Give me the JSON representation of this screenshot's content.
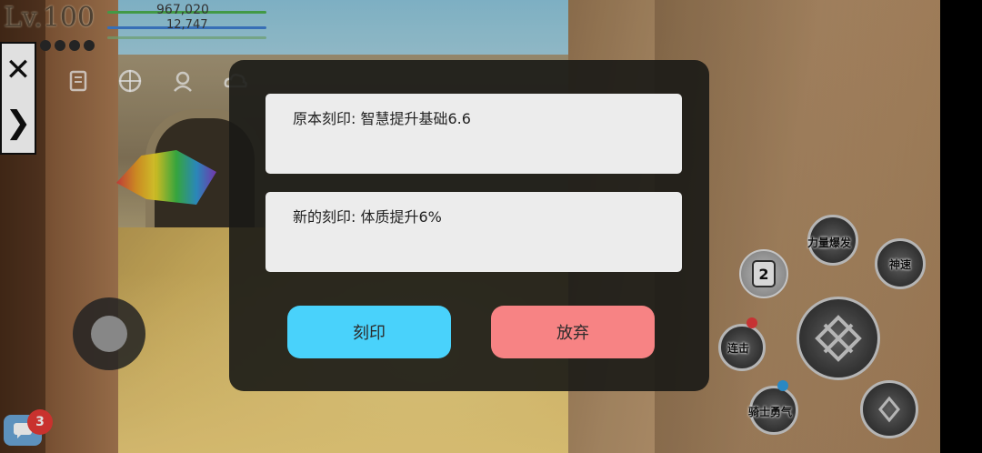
{
  "hud": {
    "level": "Lv.100",
    "hp_value": "967,020",
    "mp_value": "12,747",
    "hp_color": "#4caf50",
    "mp_color": "#3f7fd0"
  },
  "side_panel": {
    "close_symbol": "✕",
    "expand_symbol": "❯"
  },
  "top_icons": [
    "scroll-icon",
    "crosshair-icon",
    "voice-icon",
    "cloud-icon"
  ],
  "modal": {
    "original_engraving": "原本刻印: 智慧提升基础6.6",
    "new_engraving": "新的刻印: 体质提升6%",
    "engrave_button": "刻印",
    "discard_button": "放弃",
    "engrave_color": "#49d2fb",
    "discard_color": "#f78384"
  },
  "skills": {
    "power_burst": "力量爆发",
    "god_speed": "神速",
    "combo": "连击",
    "knight_courage": "骑士勇气",
    "potion_count": "2"
  },
  "chat": {
    "unread_count": "3"
  }
}
